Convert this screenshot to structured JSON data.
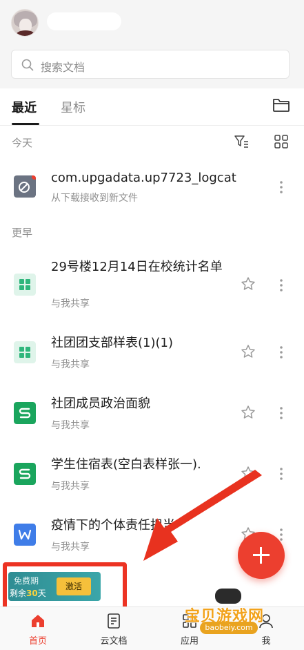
{
  "search": {
    "placeholder": "搜索文档"
  },
  "tabs": [
    {
      "label": "最近",
      "active": true
    },
    {
      "label": "星标",
      "active": false
    }
  ],
  "sections": {
    "today": "今天",
    "earlier": "更早"
  },
  "files": [
    {
      "title": "com.upgadata.up7723_logcat",
      "subtitle": "从下载接收到新文件",
      "icon": "log-file-icon",
      "icon_color": "#6b7382",
      "unread_dot": true,
      "starrable": false
    },
    {
      "title": "29号楼12月14日在校统计名单",
      "subtitle": "与我共享",
      "icon": "form-icon",
      "icon_color": "#2fb67c",
      "starrable": true
    },
    {
      "title": "社团团支部样表(1)(1)",
      "subtitle": "与我共享",
      "icon": "form-icon",
      "icon_color": "#2fb67c",
      "starrable": true
    },
    {
      "title": "社团成员政治面貌",
      "subtitle": "与我共享",
      "icon": "spreadsheet-icon",
      "icon_color": "#1aa55d",
      "starrable": true
    },
    {
      "title": "学生住宿表(空白表样张一).",
      "subtitle": "与我共享",
      "icon": "spreadsheet-icon",
      "icon_color": "#1aa55d",
      "starrable": true
    },
    {
      "title": "疫情下的个体责任担当",
      "subtitle": "与我共享",
      "icon": "word-doc-icon",
      "icon_color": "#3f7de8",
      "starrable": true
    }
  ],
  "trial": {
    "line1": "免费期",
    "line2_prefix": "剩余",
    "days": "30",
    "line2_suffix": "天",
    "button": "激活"
  },
  "bottom_nav": [
    {
      "label": "首页",
      "icon": "home-icon",
      "active": true
    },
    {
      "label": "云文档",
      "icon": "cloud-doc-icon",
      "active": false
    },
    {
      "label": "应用",
      "icon": "apps-icon",
      "active": false
    },
    {
      "label": "我",
      "icon": "profile-icon",
      "active": false
    }
  ],
  "watermark": {
    "text": "宝贝游戏网",
    "url": "baobeiy.com"
  },
  "colors": {
    "accent": "#ec3f2f",
    "annotation": "#ec3323"
  }
}
